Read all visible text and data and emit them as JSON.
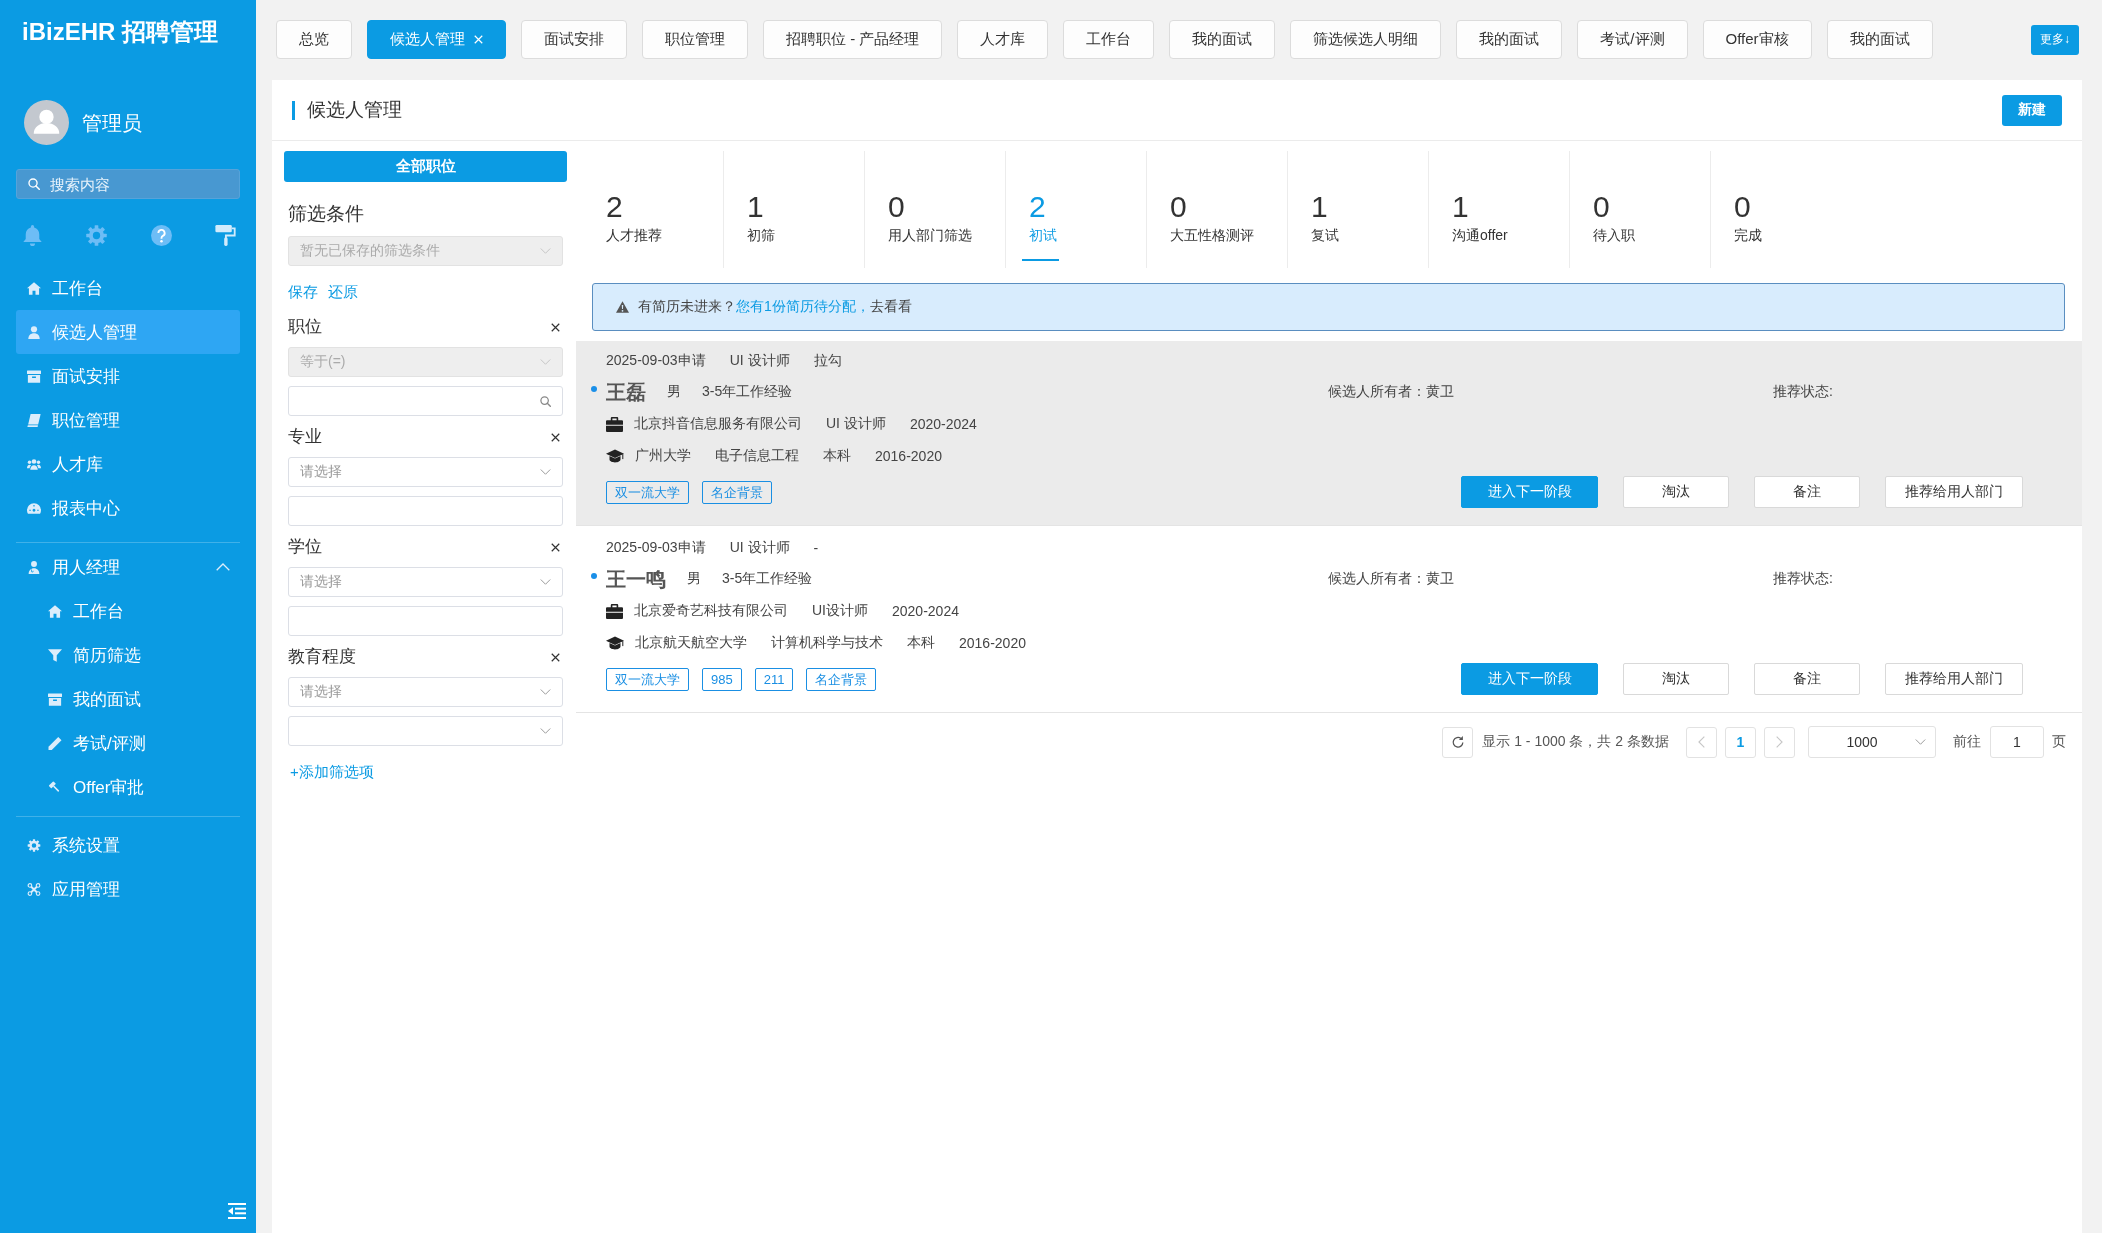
{
  "sidebar": {
    "title": "iBizEHR 招聘管理",
    "user": {
      "name": "管理员"
    },
    "search": {
      "placeholder": "搜索内容"
    },
    "menu": [
      {
        "label": "工作台",
        "selected": false
      },
      {
        "label": "候选人管理",
        "selected": true
      },
      {
        "label": "面试安排",
        "selected": false
      },
      {
        "label": "职位管理",
        "selected": false
      },
      {
        "label": "人才库",
        "selected": false
      },
      {
        "label": "报表中心",
        "selected": false
      }
    ],
    "group": {
      "label": "用人经理",
      "expanded": true,
      "children": [
        {
          "label": "工作台",
          "selected": false
        },
        {
          "label": "简历筛选",
          "selected": false
        },
        {
          "label": "我的面试",
          "selected": false
        },
        {
          "label": "考试/评测",
          "selected": false
        },
        {
          "label": "Offer审批",
          "selected": false
        }
      ]
    },
    "footer_menu": [
      {
        "label": "系统设置",
        "selected": false
      },
      {
        "label": "应用管理",
        "selected": false
      }
    ]
  },
  "tabs": [
    {
      "label": "总览",
      "selected": false
    },
    {
      "label": "候选人管理",
      "selected": true
    },
    {
      "label": "面试安排",
      "selected": false
    },
    {
      "label": "职位管理",
      "selected": false
    },
    {
      "label": "招聘职位 - 产品经理",
      "selected": false
    },
    {
      "label": "人才库",
      "selected": false
    },
    {
      "label": "工作台",
      "selected": false
    },
    {
      "label": "我的面试",
      "selected": false
    },
    {
      "label": "筛选候选人明细",
      "selected": false
    },
    {
      "label": "我的面试",
      "selected": false
    },
    {
      "label": "考试/评测",
      "selected": false
    },
    {
      "label": "Offer审核",
      "selected": false
    },
    {
      "label": "我的面试",
      "selected": false
    }
  ],
  "more_button": {
    "label": "更多↓"
  },
  "page": {
    "title": "候选人管理",
    "new_button": "新建"
  },
  "filters": {
    "all_button": "全部职位",
    "title": "筛选条件",
    "saved": {
      "placeholder": "暂无已保存的筛选条件",
      "disabled": true
    },
    "links": [
      "保存",
      "还原"
    ],
    "groups": [
      {
        "label": "职位",
        "fields": [
          {
            "kind": "select",
            "value": "等于(=)",
            "disabled": true
          },
          {
            "kind": "search",
            "disabled": false
          }
        ]
      },
      {
        "label": "专业",
        "fields": [
          {
            "kind": "select",
            "placeholder": "请选择",
            "disabled": false
          },
          {
            "kind": "text",
            "disabled": false
          }
        ]
      },
      {
        "label": "学位",
        "fields": [
          {
            "kind": "select",
            "placeholder": "请选择",
            "disabled": false
          },
          {
            "kind": "text",
            "disabled": false
          }
        ]
      },
      {
        "label": "教育程度",
        "fields": [
          {
            "kind": "select",
            "placeholder": "请选择",
            "disabled": false
          },
          {
            "kind": "select",
            "disabled": false
          }
        ]
      }
    ],
    "add_link": "+添加筛选项"
  },
  "stages": [
    {
      "count": "2",
      "label": "人才推荐",
      "selected": false
    },
    {
      "count": "1",
      "label": "初筛",
      "selected": false
    },
    {
      "count": "0",
      "label": "用人部门筛选",
      "selected": false
    },
    {
      "count": "2",
      "label": "初试",
      "selected": true
    },
    {
      "count": "0",
      "label": "大五性格测评",
      "selected": false
    },
    {
      "count": "1",
      "label": "复试",
      "selected": false
    },
    {
      "count": "1",
      "label": "沟通offer",
      "selected": false
    },
    {
      "count": "0",
      "label": "待入职",
      "selected": false
    },
    {
      "count": "0",
      "label": "完成",
      "selected": false
    }
  ],
  "alert": {
    "text": "有简历未进来？",
    "link": "您有1份简历待分配，",
    "tail": "去看看"
  },
  "candidates": [
    {
      "selected": true,
      "applied": "2025-09-03申请",
      "position": "UI 设计师",
      "source": "拉勾",
      "name": "王磊",
      "gender": "男",
      "experience": "3-5年工作经验",
      "owner": "候选人所有者：黄卫",
      "status_label": "推荐状态:",
      "work": {
        "company": "北京抖音信息服务有限公司",
        "title": "UI 设计师",
        "period": "2020-2024"
      },
      "education": {
        "school": "广州大学",
        "major": "电子信息工程",
        "degree": "本科",
        "period": "2016-2020"
      },
      "tags": [
        "双一流大学",
        "名企背景"
      ],
      "actions": [
        {
          "label": "进入下一阶段",
          "kind": "primary"
        },
        {
          "label": "淘汰",
          "kind": "default"
        },
        {
          "label": "备注",
          "kind": "default"
        },
        {
          "label": "推荐给用人部门",
          "kind": "default"
        }
      ]
    },
    {
      "selected": false,
      "applied": "2025-09-03申请",
      "position": "UI 设计师",
      "source": "-",
      "name": "王一鸣",
      "gender": "男",
      "experience": "3-5年工作经验",
      "owner": "候选人所有者：黄卫",
      "status_label": "推荐状态:",
      "work": {
        "company": "北京爱奇艺科技有限公司",
        "title": "UI设计师",
        "period": "2020-2024"
      },
      "education": {
        "school": "北京航天航空大学",
        "major": "计算机科学与技术",
        "degree": "本科",
        "period": "2016-2020"
      },
      "tags": [
        "双一流大学",
        "985",
        "211",
        "名企背景"
      ],
      "actions": [
        {
          "label": "进入下一阶段",
          "kind": "primary"
        },
        {
          "label": "淘汰",
          "kind": "default"
        },
        {
          "label": "备注",
          "kind": "default"
        },
        {
          "label": "推荐给用人部门",
          "kind": "default"
        }
      ]
    }
  ],
  "pagination": {
    "summary": "显示 1 - 1000 条，共 2 条数据",
    "prev": {
      "disabled": true
    },
    "pages": [
      {
        "label": "1",
        "selected": true
      }
    ],
    "next": {
      "disabled": true
    },
    "page_size": "1000",
    "goto_label": "前往",
    "goto_value": "1",
    "unit": "页"
  }
}
